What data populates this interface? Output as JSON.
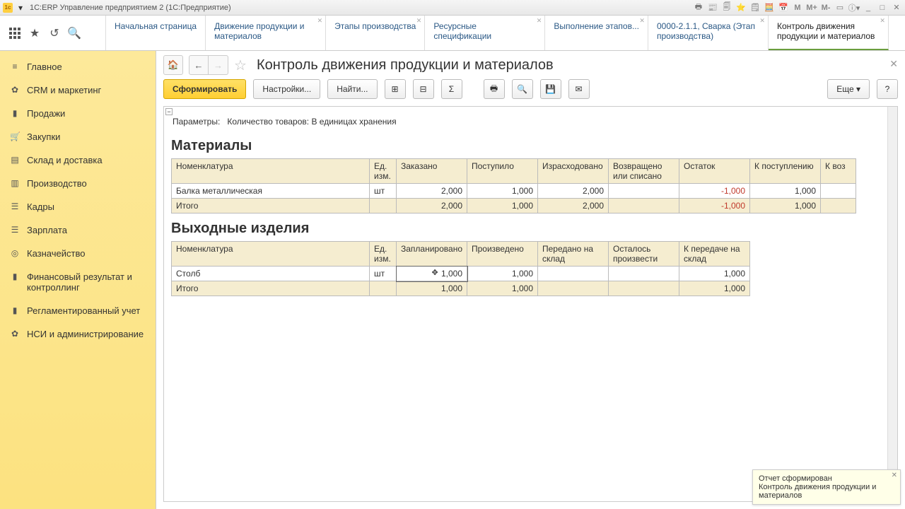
{
  "window": {
    "title": "1С:ERP Управление предприятием 2  (1С:Предприятие)"
  },
  "title_icons": [
    "🖶",
    "📰",
    "🗐",
    "⭐",
    "🗒",
    "🧮",
    "📅",
    "M",
    "M+",
    "M-",
    "▭",
    "ⓘ▾",
    "_",
    "□",
    "✕"
  ],
  "tabbar_left_icons": [
    "grid",
    "★",
    "⎘",
    "🔍"
  ],
  "tabs": [
    {
      "label": "Начальная страница",
      "closable": false
    },
    {
      "label": "Движение продукции и материалов",
      "closable": true
    },
    {
      "label": "Этапы производства",
      "closable": true
    },
    {
      "label": "Ресурсные спецификации",
      "closable": true
    },
    {
      "label": "Выполнение этапов...",
      "closable": true
    },
    {
      "label": "0000-2.1.1, Сварка (Этап производства)",
      "closable": true
    },
    {
      "label": "Контроль движения продукции и материалов",
      "closable": true,
      "active": true
    }
  ],
  "sidebar": [
    {
      "icon": "≡",
      "label": "Главное"
    },
    {
      "icon": "✿",
      "label": "CRM и маркетинг"
    },
    {
      "icon": "▮",
      "label": "Продажи"
    },
    {
      "icon": "🛒",
      "label": "Закупки"
    },
    {
      "icon": "▤",
      "label": "Склад и доставка"
    },
    {
      "icon": "▥",
      "label": "Производство"
    },
    {
      "icon": "☰",
      "label": "Кадры"
    },
    {
      "icon": "☰",
      "label": "Зарплата"
    },
    {
      "icon": "◎",
      "label": "Казначейство"
    },
    {
      "icon": "▮",
      "label": "Финансовый результат и контроллинг"
    },
    {
      "icon": "▮",
      "label": "Регламентированный учет"
    },
    {
      "icon": "✿",
      "label": "НСИ и администрирование"
    }
  ],
  "page": {
    "title": "Контроль движения продукции и материалов",
    "btn_form": "Сформировать",
    "btn_settings": "Настройки...",
    "btn_find": "Найти...",
    "btn_more": "Еще ▾",
    "btn_help": "?",
    "params_label": "Параметры:",
    "params_value": "Количество товаров: В единицах хранения"
  },
  "materials": {
    "heading": "Материалы",
    "columns": [
      "Номенклатура",
      "Ед. изм.",
      "Заказано",
      "Поступило",
      "Израсходовано",
      "Возвращено или списано",
      "Остаток",
      "К поступлению",
      "К воз"
    ],
    "rows": [
      {
        "name": "Балка металлическая",
        "unit": "шт",
        "ordered": "2,000",
        "received": "1,000",
        "used": "2,000",
        "returned": "",
        "balance": "-1,000",
        "to_receive": "1,000",
        "to_ret": ""
      }
    ],
    "total": {
      "name": "Итого",
      "ordered": "2,000",
      "received": "1,000",
      "used": "2,000",
      "returned": "",
      "balance": "-1,000",
      "to_receive": "1,000",
      "to_ret": ""
    }
  },
  "products": {
    "heading": "Выходные изделия",
    "columns": [
      "Номенклатура",
      "Ед. изм.",
      "Запланировано",
      "Произведено",
      "Передано на склад",
      "Осталось произвести",
      "К передаче на склад"
    ],
    "rows": [
      {
        "name": "Столб",
        "unit": "шт",
        "planned": "1,000",
        "produced": "1,000",
        "to_wh": "",
        "remain": "",
        "to_transfer": "1,000"
      }
    ],
    "total": {
      "name": "Итого",
      "planned": "1,000",
      "produced": "1,000",
      "to_wh": "",
      "remain": "",
      "to_transfer": "1,000"
    }
  },
  "notification": {
    "title": "Отчет сформирован",
    "text": "Контроль движения продукции и материалов"
  }
}
